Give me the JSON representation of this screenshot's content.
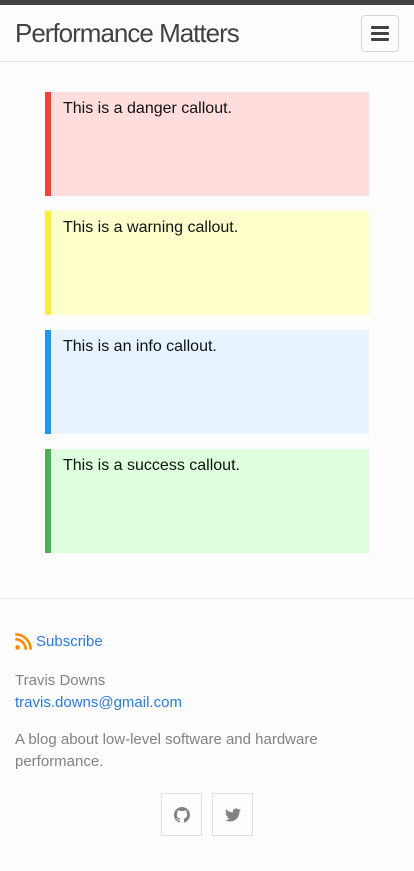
{
  "header": {
    "site_title": "Performance Matters",
    "menu_icon": "hamburger-icon"
  },
  "callouts": [
    {
      "text": "This is a danger callout.",
      "type": "danger",
      "bg": "#ffdddd",
      "bar": "#f44336"
    },
    {
      "text": "This is a warning callout.",
      "type": "warning",
      "bg": "#ffffcc",
      "bar": "#ffeb3b"
    },
    {
      "text": "This is an info callout.",
      "type": "info",
      "bg": "#e7f3ff",
      "bar": "#2196f3"
    },
    {
      "text": "This is a success callout.",
      "type": "success",
      "bg": "#ddffdd",
      "bar": "#4caf50"
    }
  ],
  "footer": {
    "subscribe_label": "Subscribe",
    "subscribe_icon": "rss-icon",
    "author_name": "Travis Downs",
    "author_email": "travis.downs@gmail.com",
    "description": "A blog about low-level software and hardware performance.",
    "social": [
      {
        "icon": "github-icon"
      },
      {
        "icon": "twitter-icon"
      }
    ]
  },
  "colors": {
    "link": "#2a7ae2",
    "muted_text": "#828282",
    "rss": "#ff8c00"
  }
}
